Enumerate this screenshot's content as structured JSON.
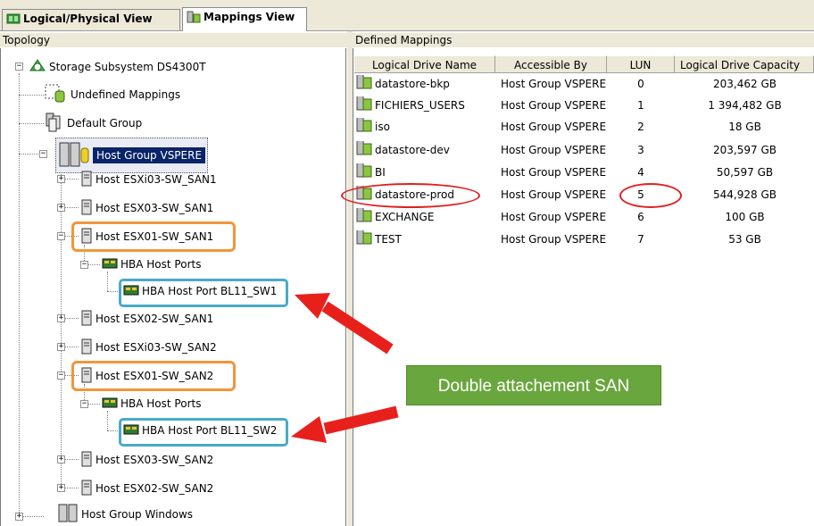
{
  "tabs": [
    {
      "label": "Logical/Physical View",
      "icon": "logical-view-icon"
    },
    {
      "label": "Mappings View",
      "icon": "mappings-view-icon"
    }
  ],
  "topology": {
    "header": "Topology",
    "nodes": [
      {
        "label": "Storage Subsystem DS4300T",
        "icon": "storage-subsystem-icon"
      },
      {
        "label": "Undefined Mappings",
        "icon": "undefined-mappings-icon"
      },
      {
        "label": "Default Group",
        "icon": "host-group-icon"
      },
      {
        "label": "Host Group VSPERE",
        "icon": "host-group-icon"
      },
      {
        "label": "Host ESXi03-SW_SAN1",
        "icon": "host-icon"
      },
      {
        "label": "Host ESX03-SW_SAN1",
        "icon": "host-icon"
      },
      {
        "label": "Host ESX01-SW_SAN1",
        "icon": "host-icon"
      },
      {
        "label": "HBA Host Ports",
        "icon": "hba-card-icon"
      },
      {
        "label": "HBA Host Port BL11_SW1",
        "icon": "hba-card-icon"
      },
      {
        "label": "Host ESX02-SW_SAN1",
        "icon": "host-icon"
      },
      {
        "label": "Host ESXi03-SW_SAN2",
        "icon": "host-icon"
      },
      {
        "label": "Host ESX01-SW_SAN2",
        "icon": "host-icon"
      },
      {
        "label": "HBA Host Ports",
        "icon": "hba-card-icon"
      },
      {
        "label": "HBA Host Port BL11_SW2",
        "icon": "hba-card-icon"
      },
      {
        "label": "Host ESX03-SW_SAN2",
        "icon": "host-icon"
      },
      {
        "label": "Host ESX02-SW_SAN2",
        "icon": "host-icon"
      },
      {
        "label": "Host Group Windows",
        "icon": "host-group-icon"
      }
    ]
  },
  "mappings": {
    "header": "Defined Mappings",
    "columns": [
      "Logical Drive Name",
      "Accessible By",
      "LUN",
      "Logical Drive Capacity"
    ],
    "rows": [
      {
        "name": "datastore-bkp",
        "access": "Host Group VSPERE",
        "lun": "0",
        "capacity": "203,462 GB"
      },
      {
        "name": "FICHIERS_USERS",
        "access": "Host Group VSPERE",
        "lun": "1",
        "capacity": "1 394,482 GB"
      },
      {
        "name": "iso",
        "access": "Host Group VSPERE",
        "lun": "2",
        "capacity": "18 GB"
      },
      {
        "name": "datastore-dev",
        "access": "Host Group VSPERE",
        "lun": "3",
        "capacity": "203,597 GB"
      },
      {
        "name": "BI",
        "access": "Host Group VSPERE",
        "lun": "4",
        "capacity": "50,597 GB"
      },
      {
        "name": "datastore-prod",
        "access": "Host Group VSPERE",
        "lun": "5",
        "capacity": "544,928 GB"
      },
      {
        "name": "EXCHANGE",
        "access": "Host Group VSPERE",
        "lun": "6",
        "capacity": "100 GB"
      },
      {
        "name": "TEST",
        "access": "Host Group VSPERE",
        "lun": "7",
        "capacity": "53 GB"
      }
    ]
  },
  "annotation": {
    "callout": "Double attachement SAN"
  },
  "colors": {
    "selection": "#0a246a",
    "oval": "#e02020",
    "highlight_orange": "#f0963c",
    "highlight_cyan": "#4aaac8",
    "callout_bg": "#6aa63e",
    "arrow": "#e8201c"
  }
}
